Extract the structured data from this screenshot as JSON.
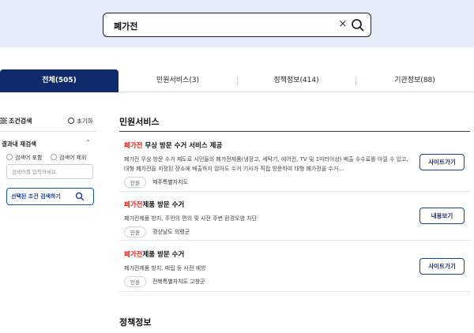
{
  "search": {
    "query": "폐가전",
    "clear_label": "×"
  },
  "tabs": [
    {
      "label": "전체(505)",
      "active": true
    },
    {
      "label": "민원서비스(3)",
      "active": false
    },
    {
      "label": "정책정보(414)",
      "active": false
    },
    {
      "label": "기관정보(88)",
      "active": false
    }
  ],
  "sidebar": {
    "condition_title": "조건검색",
    "reset_label": "초기화",
    "refine_title": "결과내 재검색",
    "options": [
      "검색어 포함",
      "검색어 제외"
    ],
    "input_placeholder": "검색어를 입력하세요.",
    "apply_label": "선택된 조건 검색하기"
  },
  "sections": {
    "civil_title": "민원서비스",
    "policy_title": "정책정보"
  },
  "results": [
    {
      "title_highlight": "폐가전",
      "title_rest": " 무상 방문 수거 서비스 제공",
      "desc": "폐가전 무상 방문 수거 제도로 시민들의 폐가전제품(냉장고, 세탁기, 에어컨, TV 및 1미터이상) 배출 수수료를 아낄 수 있고, 대형 폐가전을 지정된 장소에 배출하지 않아도 수거 기사가 직접 방문하여 대형 폐가전을 수거...",
      "badge": "민원",
      "org": "제주특별자치도",
      "action": "사이트가기"
    },
    {
      "title_highlight": "폐가전",
      "title_rest": "제품 방문 수거",
      "desc": "폐가전제품 방치, 주민의 편의 및 사전 주변 환경오염 차단",
      "badge": "민원",
      "org": "경상남도 의령군",
      "action": "내용보기"
    },
    {
      "title_highlight": "폐가전",
      "title_rest": "제품 방문 수거",
      "desc": "폐가전제품 방치, 매립 등 사전 예방",
      "badge": "민원",
      "org": "전북특별자치도 고창군",
      "action": "사이트가기"
    }
  ],
  "colors": {
    "header_bg": "#e6edf8",
    "active_tab": "#0f2b6b",
    "highlight": "#e0261b",
    "button_border": "#1b3f9c"
  }
}
